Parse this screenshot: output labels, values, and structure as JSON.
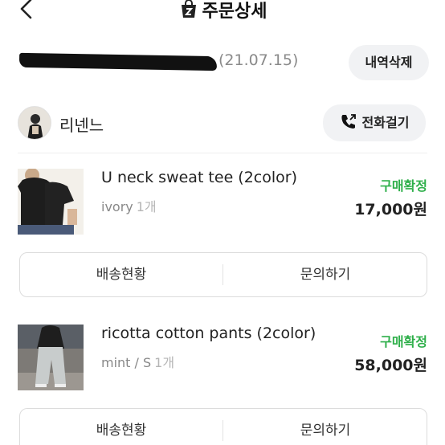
{
  "header": {
    "title": "주문상세"
  },
  "order": {
    "number_redacted": true,
    "date": "(21.07.15)",
    "delete_label": "내역삭제"
  },
  "shop": {
    "name": "리넨느",
    "call_label": "전화걸기"
  },
  "items": [
    {
      "name": "U neck sweat tee (2color)",
      "option": "ivory",
      "qty": "1개",
      "status": "구매확정",
      "price": "17,000원",
      "actions": {
        "shipping": "배송현황",
        "inquiry": "문의하기"
      }
    },
    {
      "name": "ricotta cotton pants (2color)",
      "option": "mint / S",
      "qty": "1개",
      "status": "구매확정",
      "price": "58,000원",
      "actions": {
        "shipping": "배송현황",
        "inquiry": "문의하기"
      }
    }
  ],
  "colors": {
    "status_green": "#2eaf4a",
    "pill_bg": "#f1f2f4",
    "muted_text": "#888888"
  }
}
